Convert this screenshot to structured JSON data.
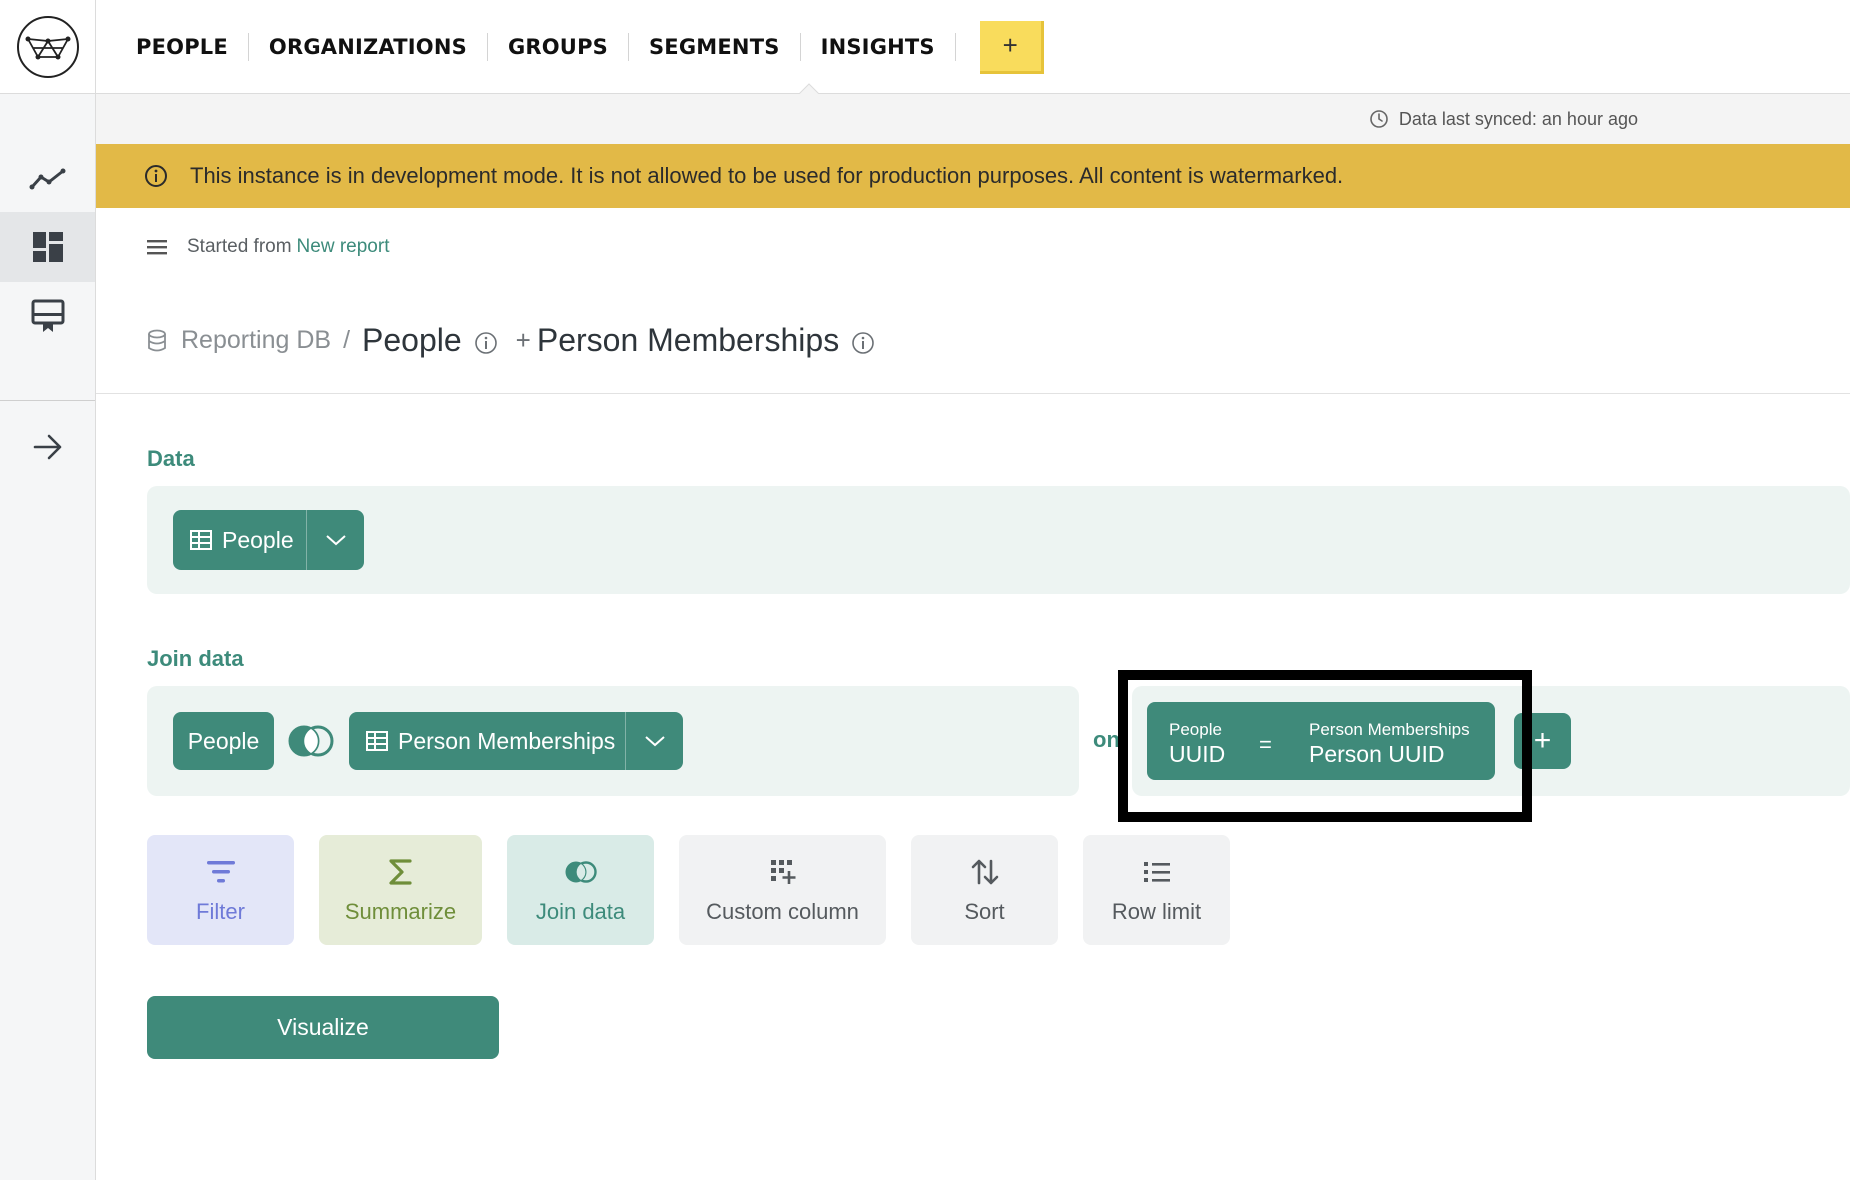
{
  "nav": {
    "items": [
      "PEOPLE",
      "ORGANIZATIONS",
      "GROUPS",
      "SEGMENTS",
      "INSIGHTS"
    ],
    "plus_label": "+"
  },
  "sync": {
    "text": "Data last synced: an hour ago"
  },
  "banner": {
    "text": "This instance is in development mode. It is not allowed to be used for production purposes. All content is watermarked."
  },
  "started": {
    "prefix": "Started from",
    "link": "New report"
  },
  "breadcrumb": {
    "database": "Reporting DB",
    "separator": "/",
    "table": "People",
    "join_prefix": "+",
    "join_table": "Person Memberships"
  },
  "data_section": {
    "label": "Data",
    "table": "People"
  },
  "join_section": {
    "label": "Join data",
    "left_table": "People",
    "right_table": "Person Memberships",
    "on_label": "on",
    "condition": {
      "left_table": "People",
      "left_column": "UUID",
      "operator": "=",
      "right_table": "Person Memberships",
      "right_column": "Person UUID"
    },
    "add_condition_label": "+"
  },
  "actions": [
    {
      "label": "Filter",
      "icon": "filter-icon"
    },
    {
      "label": "Summarize",
      "icon": "sigma-icon"
    },
    {
      "label": "Join data",
      "icon": "join-icon"
    },
    {
      "label": "Custom column",
      "icon": "grid-plus-icon"
    },
    {
      "label": "Sort",
      "icon": "sort-arrows-icon"
    },
    {
      "label": "Row limit",
      "icon": "list-icon"
    }
  ],
  "visualize": {
    "label": "Visualize"
  },
  "colors": {
    "brand_green": "#3f8a7a",
    "banner_yellow": "#e2b947",
    "plus_yellow": "#f9dc5c",
    "filter_bg": "#e3e6f8",
    "summarize_bg": "#e6ecd8",
    "join_bg": "#d9ebe7"
  }
}
